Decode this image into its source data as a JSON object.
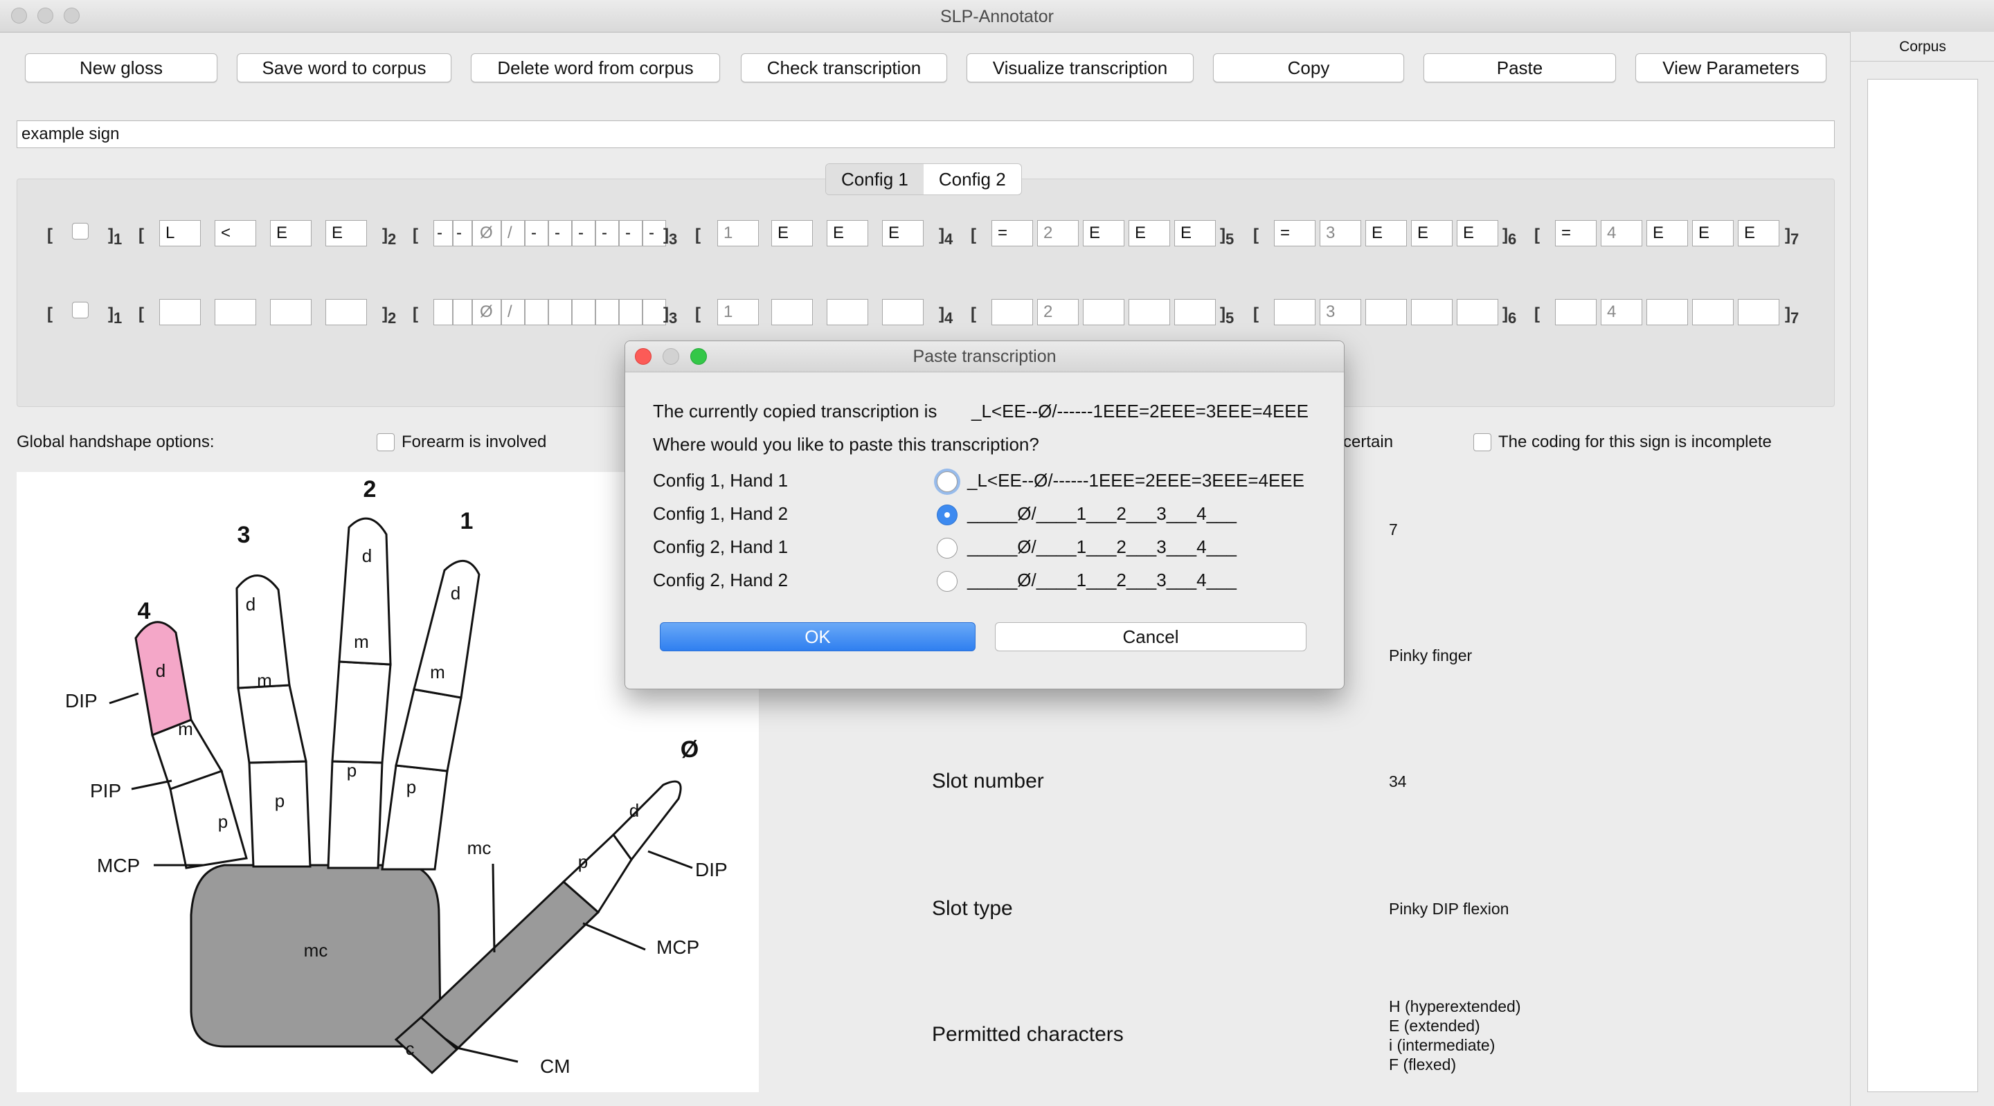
{
  "window": {
    "title": "SLP-Annotator"
  },
  "toolbar": {
    "buttons": [
      "New gloss",
      "Save word to corpus",
      "Delete word from corpus",
      "Check transcription",
      "Visualize transcription",
      "Copy",
      "Paste",
      "View Parameters"
    ]
  },
  "gloss": {
    "value": "example sign"
  },
  "config_tabs": {
    "tab1": "Config 1",
    "tab2": "Config 2",
    "selected": "Config 1"
  },
  "hand1": {
    "f2": [
      "L",
      "<",
      "E",
      "E"
    ],
    "f3": [
      "-",
      "-",
      "Ø",
      "/",
      "-",
      "-",
      "-",
      "-",
      "-",
      "-"
    ],
    "f4": [
      "1",
      "E",
      "E",
      "E"
    ],
    "f5": [
      "=",
      "2",
      "E",
      "E",
      "E"
    ],
    "f6": [
      "=",
      "3",
      "E",
      "E",
      "E"
    ],
    "f7": [
      "=",
      "4",
      "E",
      "E",
      "E"
    ]
  },
  "hand2": {
    "f3_fixed": [
      "Ø",
      "/"
    ],
    "f4": "1",
    "f5": "2",
    "f6": "3",
    "f7": "4"
  },
  "bracket_subs": [
    "1",
    "2",
    "3",
    "4",
    "5",
    "6",
    "7"
  ],
  "options": {
    "global_label": "Global handshape options:",
    "forearm": "Forearm is involved",
    "uncertain_fragment": "certain",
    "incomplete": "The coding for this sign is incomplete"
  },
  "hand_diagram": {
    "finger_numbers": [
      "4",
      "3",
      "2",
      "1",
      "Ø"
    ],
    "joint_labels": [
      "DIP",
      "PIP",
      "MCP",
      "DIP",
      "MCP",
      "CM"
    ],
    "segment_labels": {
      "d": "d",
      "m": "m",
      "p": "p",
      "mc": "mc",
      "c": "c"
    },
    "highlight_color": "#f4a7c8"
  },
  "info": {
    "value_top": "7",
    "value_finger": "Pinky finger",
    "slot_number_label": "Slot number",
    "slot_number_value": "34",
    "slot_type_label": "Slot type",
    "slot_type_value": "Pinky DIP flexion",
    "permitted_label": "Permitted characters",
    "permitted": [
      "H (hyperextended)",
      "E (extended)",
      "i (intermediate)",
      "F (flexed)"
    ]
  },
  "corpus": {
    "title": "Corpus"
  },
  "dialog": {
    "title": "Paste transcription",
    "copied_prefix": "The currently copied transcription is",
    "copied_value": "_L<EE--Ø/------1EEE=2EEE=3EEE=4EEE",
    "question": "Where would you like to paste this transcription?",
    "options": [
      {
        "label": "Config 1, Hand 1",
        "value": "_L<EE--Ø/------1EEE=2EEE=3EEE=4EEE",
        "selected": false
      },
      {
        "label": "Config 1, Hand 2",
        "value": "_____Ø/____1___2___3___4___",
        "selected": true
      },
      {
        "label": "Config 2, Hand 1",
        "value": "_____Ø/____1___2___3___4___",
        "selected": false
      },
      {
        "label": "Config 2, Hand 2",
        "value": "_____Ø/____1___2___3___4___",
        "selected": false
      }
    ],
    "ok": "OK",
    "cancel": "Cancel",
    "accent": "#3d8af0"
  }
}
